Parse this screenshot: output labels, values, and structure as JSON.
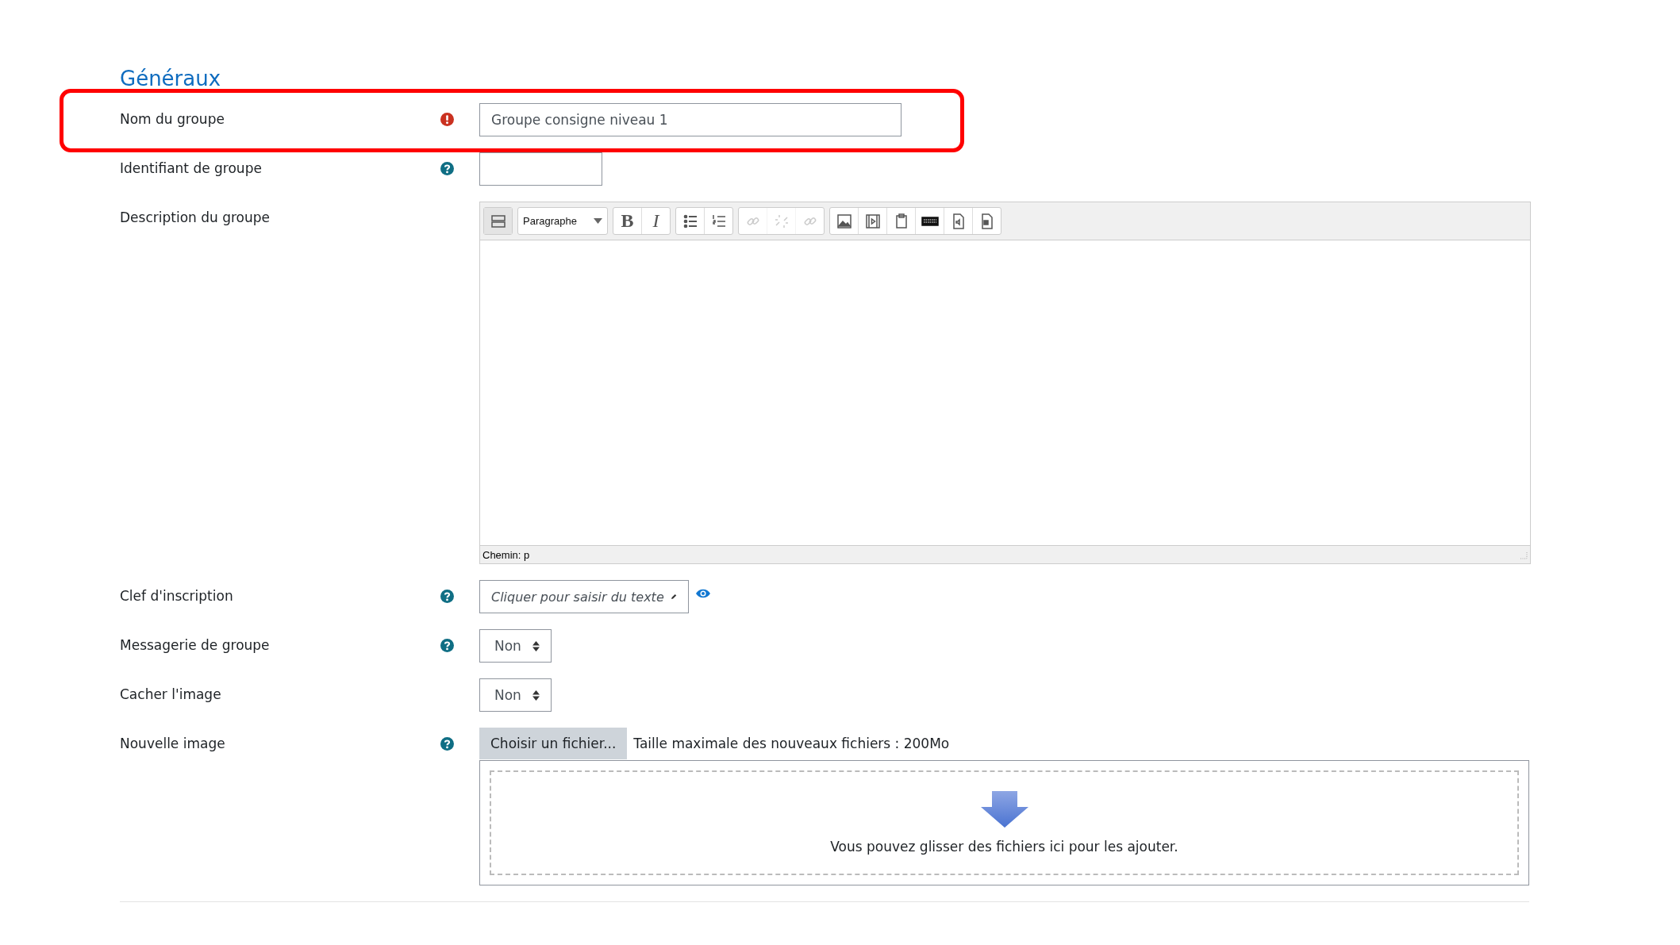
{
  "section_title": "Généraux",
  "fields": [
    {
      "kind": "text",
      "label": "Nom du groupe",
      "required": true,
      "help": false,
      "value": "Groupe consigne niveau 1",
      "highlighted": true
    },
    {
      "kind": "short",
      "label": "Identifiant de groupe",
      "required": false,
      "help": true,
      "highlighted": false
    },
    {
      "kind": "editor",
      "label": "Description du groupe",
      "required": false,
      "help": false,
      "highlighted": false,
      "editor": {
        "format": "Paragraphe",
        "path": "Chemin: p",
        "groups": [
          [
            {
              "kind": "toolbar-toggle",
              "disabled": false
            }
          ],
          [
            {
              "kind": "format",
              "disabled": false
            }
          ],
          [
            {
              "kind": "bold",
              "label": "B",
              "disabled": false
            },
            {
              "kind": "italic",
              "label": "I",
              "disabled": false
            }
          ],
          [
            {
              "kind": "bullets",
              "disabled": false
            },
            {
              "kind": "numbers",
              "disabled": false
            }
          ],
          [
            {
              "kind": "link",
              "disabled": true
            },
            {
              "kind": "unlink",
              "disabled": true
            },
            {
              "kind": "anchor",
              "disabled": true
            }
          ],
          [
            {
              "kind": "image",
              "disabled": false
            },
            {
              "kind": "media",
              "disabled": false
            },
            {
              "kind": "paste",
              "disabled": false
            },
            {
              "kind": "keyboard",
              "disabled": false
            },
            {
              "kind": "audio",
              "disabled": false
            },
            {
              "kind": "video",
              "disabled": false
            }
          ]
        ]
      }
    },
    {
      "kind": "secret",
      "label": "Clef d'inscription",
      "required": false,
      "help": true,
      "value": "Cliquer pour saisir du texte",
      "highlighted": false
    },
    {
      "kind": "select",
      "label": "Messagerie de groupe",
      "required": false,
      "help": true,
      "value": "Non",
      "highlighted": false
    },
    {
      "kind": "select",
      "label": "Cacher l'image",
      "required": false,
      "help": false,
      "value": "Non",
      "highlighted": false
    },
    {
      "kind": "file",
      "label": "Nouvelle image",
      "required": false,
      "help": true,
      "button": "Choisir un fichier...",
      "limit": "Taille maximale des nouveaux fichiers : 200Mo",
      "drop": "Vous pouvez glisser des fichiers ici pour les ajouter.",
      "highlighted": false
    }
  ]
}
